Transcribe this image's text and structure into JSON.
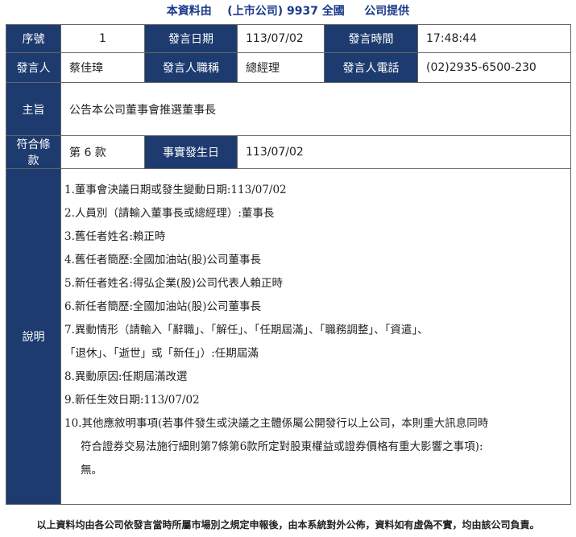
{
  "header": {
    "title_prefix": "本資料由",
    "company": "(上市公司) 9937 全國",
    "title_suffix": "公司提供"
  },
  "table": {
    "serial_label": "序號",
    "serial_value": "1",
    "date_label": "發言日期",
    "date_value": "113/07/02",
    "time_label": "發言時間",
    "time_value": "17:48:44",
    "speaker_label": "發言人",
    "speaker_value": "蔡佳璋",
    "title_label": "發言人職稱",
    "title_value": "總經理",
    "phone_label": "發言人電話",
    "phone_value": "(02)2935-6500-230",
    "subject_label": "主旨",
    "subject_value": "公告本公司董事會推選董事長",
    "clause_label": "符合條款",
    "clause_value": "第 6 款",
    "event_date_label": "事實發生日",
    "event_date_value": "113/07/02",
    "desc_label": "說明",
    "description": [
      "1.董事會決議日期或發生變動日期:113/07/02",
      "2.人員別（請輸入董事長或總經理）:董事長",
      "3.舊任者姓名:賴正時",
      "4.舊任者簡歷:全國加油站(股)公司董事長",
      "5.新任者姓名:得弘企業(股)公司代表人賴正時",
      "6.新任者簡歷:全國加油站(股)公司董事長",
      "7.異動情形（請輸入「辭職」、「解任」、「任期屆滿」、「職務調整」、「資遣」、",
      "「退休」、「逝世」或「新任」）:任期屆滿",
      "8.異動原因:任期屆滿改選",
      "9.新任生效日期:113/07/02",
      "10.其他應敘明事項(若事件發生或決議之主體係屬公開發行以上公司，本則重大訊息同時",
      "符合證券交易法施行細則第7條第6款所定對股東權益或證券價格有重大影響之事項):",
      "無。"
    ]
  },
  "footer": {
    "note": "以上資料均由各公司依發言當時所屬市場別之規定申報後，由本系統對外公佈，資料如有虛偽不實，均由該公司負責。"
  }
}
